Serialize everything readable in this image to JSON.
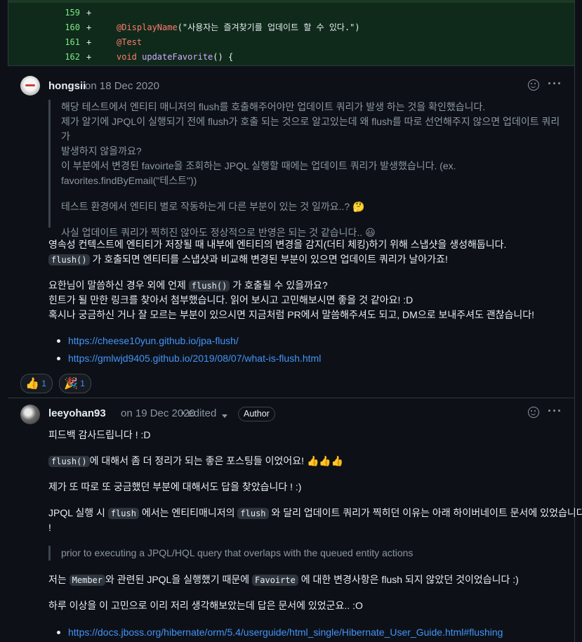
{
  "diff": {
    "rows": [
      {
        "num": "159",
        "sign": "+",
        "code": ""
      },
      {
        "num": "160",
        "sign": "+",
        "annot": "@DisplayName",
        "string": "(\"사용자는 즐겨찾기를 업데이트 할 수 있다.\")"
      },
      {
        "num": "161",
        "sign": "+",
        "annot": "@Test"
      },
      {
        "num": "162",
        "sign": "+",
        "kw": "void ",
        "fn": "updateFavorite",
        "rest": "() {"
      }
    ]
  },
  "comment1": {
    "author": "hongsii",
    "date": "on 18 Dec 2020",
    "quote": [
      "해당 테스트에서 엔티티 매니저의 flush를 호출해주어야만 업데이트 쿼리가 발생 하는 것을 확인했습니다.",
      "제가 알기에 JPQL이 실행되기 전에 flush가 호출 되는 것으로 알고있는데 왜 flush를 따로 선언해주지 않으면 업데이트 쿼리가",
      "발생하지 않을까요?",
      "이 부분에서 변경된 favoirte을 조회하는 JPQL 실행할 때에는 업데이트 쿼리가 발생했습니다. (ex.",
      "favorites.findByEmail(\"테스트\"))",
      "테스트 환경에서 엔티티 별로 작동하는게 다른 부분이 있는 것 일까요..? 🤔",
      "사실 업데이트 쿼리가 찍히진 않아도 정상적으로 반영은 되는 것 같습니다.. 😃"
    ]
  },
  "reply1": {
    "p1": "영속성 컨텍스트에 엔티티가 저장될 때 내부에 엔티티의 변경을 감지(더티 체킹)하기 위해 스냅샷을 생성해둡니다.",
    "p2_code": "flush()",
    "p2_text": " 가 호출되면 엔티티를 스냅샷과 비교해 변경된 부분이 있으면 업데이트 쿼리가 날아가죠!",
    "p3_a": "요한님이 말씀하신 경우 외에 언제 ",
    "p3_code": "flush()",
    "p3_b": " 가 호출될 수 있을까요?",
    "p4": "힌트가 될 만한 링크를 찾아서 첨부했습니다. 읽어 보시고 고민해보시면 좋을 것 같아요! :D",
    "p5": "혹시나 궁금하신 거나 잘 모르는 부분이 있으시면 지금처럼 PR에서 말씀해주셔도 되고, DM으로 보내주셔도 괜찮습니다!",
    "links": [
      "https://cheese10yun.github.io/jpa-flush/",
      "https://gmlwjd9405.github.io/2019/08/07/what-is-flush.html"
    ],
    "reactions": [
      {
        "emoji": "👍",
        "count": "1"
      },
      {
        "emoji": "🎉",
        "count": "1"
      }
    ]
  },
  "comment2": {
    "author": "leeyohan93",
    "date": "on 19 Dec 2020",
    "edited": "• edited",
    "badge": "Author",
    "p1": "피드백 감사드립니다 ! :D",
    "p2_code": "flush()",
    "p2_text": "에 대해서 좀 더 정리가 되는 좋은 포스팅들 이었어요! 👍👍👍",
    "p3": "제가 또 따로 또 궁금했던 부분에 대해서도 답을 찾았습니다 ! :)",
    "p4_a": "JPQL 실행 시 ",
    "p4_code1": "flush",
    "p4_b": " 에서는 엔티티매니저의 ",
    "p4_code2": "flush",
    "p4_c": " 와 달리 업데이트 쿼리가 찍히던 이유는 아래 하이버네이트 문서에 있었습니다",
    "p4_d": "!",
    "quote": "prior to executing a JPQL/HQL query that overlaps with the queued entity actions",
    "p5_a": "저는 ",
    "p5_code1": "Member",
    "p5_b": "와 관련된 JPQL을 실행했기 때문에 ",
    "p5_code2": "Favoirte",
    "p5_c": " 에 대한 변경사항은 flush 되지 않았던 것이었습니다 :)",
    "p6": "하루 이상을 이 고민으로 이리 저리 생각해보았는데 답은 문서에 있었군요.. :O",
    "link": "https://docs.jboss.org/hibernate/orm/5.4/userguide/html_single/Hibernate_User_Guide.html#flushing"
  }
}
